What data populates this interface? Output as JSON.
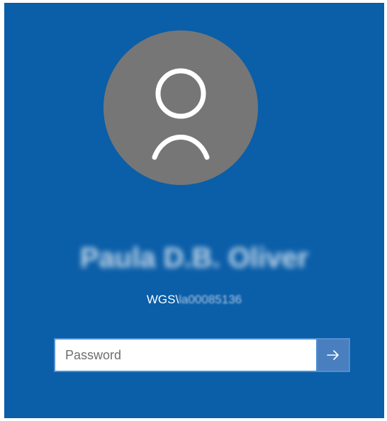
{
  "user": {
    "display_name": "Paula D.B. Oliver",
    "domain_prefix": "WGS\\",
    "account_id": "la00085136"
  },
  "password_field": {
    "placeholder": "Password",
    "value": ""
  },
  "icons": {
    "avatar": "user-silhouette-icon",
    "submit": "arrow-right-icon"
  },
  "colors": {
    "background": "#0b5ea8",
    "avatar_disc": "#767676",
    "submit_button": "#4a7fbf"
  }
}
